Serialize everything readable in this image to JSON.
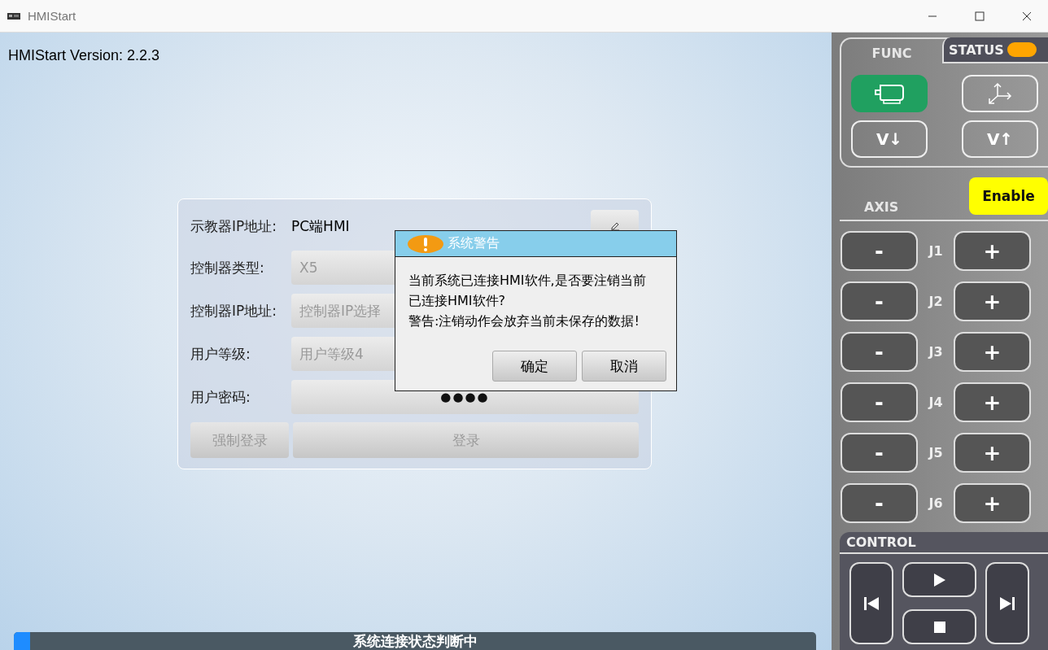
{
  "window": {
    "title": "HMIStart"
  },
  "version": "HMIStart Version: 2.2.3",
  "login_form": {
    "teach_pendant": {
      "label": "示教器IP地址:",
      "value": "PC端HMI"
    },
    "fields": [
      {
        "label": "控制器类型:",
        "value": "X5"
      },
      {
        "label": "控制器IP地址:",
        "placeholder": "控制器IP选择"
      },
      {
        "label": "用户等级:",
        "value": "用户等级4"
      },
      {
        "label": "用户密码:",
        "value": "●●●●",
        "kind": "password"
      }
    ],
    "buttons": [
      {
        "label": "强制登录",
        "disabled": true
      },
      {
        "label": "登录",
        "disabled": true
      }
    ]
  },
  "dialog": {
    "title": "系统警告",
    "message": "当前系统已连接HMI软件,是否要注销当前已连接HMI软件?",
    "warning": "警告:注销动作会放弃当前未保存的数据!",
    "buttons": [
      "确定",
      "取消"
    ]
  },
  "progress": {
    "label": "系统连接状态判断中",
    "level": 0.02
  },
  "side_panel": {
    "func_title": "FUNC",
    "status_title": "STATUS",
    "func_buttons": [
      {
        "kind": "motor",
        "selected": true
      },
      {
        "kind": "axes",
        "selected": false
      },
      {
        "kind": "text",
        "label": "V↓",
        "selected": false
      },
      {
        "kind": "text",
        "label": "V↑",
        "selected": false
      }
    ],
    "axis_title": "AXIS",
    "enable": {
      "label": "Enable",
      "on": true
    },
    "axes": [
      {
        "name": "J1",
        "minus": "-",
        "plus": "+"
      },
      {
        "name": "J2",
        "minus": "-",
        "plus": "+"
      },
      {
        "name": "J3",
        "minus": "-",
        "plus": "+"
      },
      {
        "name": "J4",
        "minus": "-",
        "plus": "+"
      },
      {
        "name": "J5",
        "minus": "-",
        "plus": "+"
      },
      {
        "name": "J6",
        "minus": "-",
        "plus": "+"
      }
    ],
    "control_title": "CONTROL"
  }
}
